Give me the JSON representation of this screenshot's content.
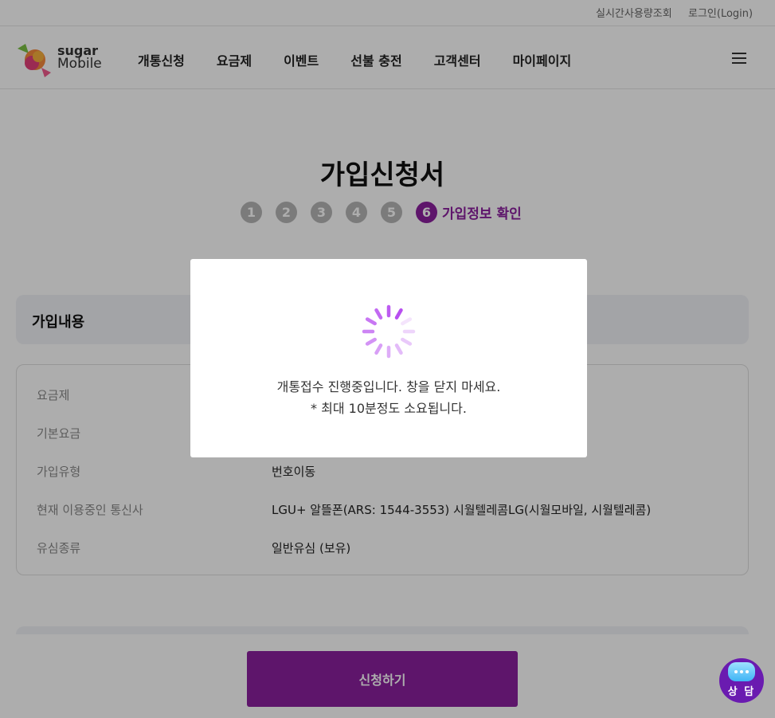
{
  "util": {
    "usage_link": "실시간사용량조회",
    "login_link": "로그인(Login)"
  },
  "header": {
    "logo": {
      "line1": "sugar",
      "line2": "Mobile"
    },
    "nav": [
      "개통신청",
      "요금제",
      "이벤트",
      "선불 충전",
      "고객센터",
      "마이페이지"
    ]
  },
  "page": {
    "title": "가입신청서",
    "steps": [
      "1",
      "2",
      "3",
      "4",
      "5",
      "6"
    ],
    "current_step_label": "가입정보 확인",
    "section_title": "가입내용",
    "rows": [
      {
        "label": "요금제",
        "value": ""
      },
      {
        "label": "기본요금",
        "value": ""
      },
      {
        "label": "가입유형",
        "value": "번호이동"
      },
      {
        "label": "현재 이용중인 통신사",
        "value": "LGU+ 알뜰폰(ARS: 1544-3553) 시월텔레콤LG(시월모바일, 시월텔레콤)"
      },
      {
        "label": "유심종류",
        "value": "일반유심 (보유)"
      }
    ],
    "apply_button": "신청하기",
    "chat_button": "상 담"
  },
  "modal": {
    "line1": "개통접수 진행중입니다. 창을 닫지 마세요.",
    "line2": "* 최대 10분정도 소요됩니다."
  },
  "colors": {
    "brand": "#8b1f9e",
    "spinner": "#b84ff0",
    "chat": "#6a1bb0"
  }
}
